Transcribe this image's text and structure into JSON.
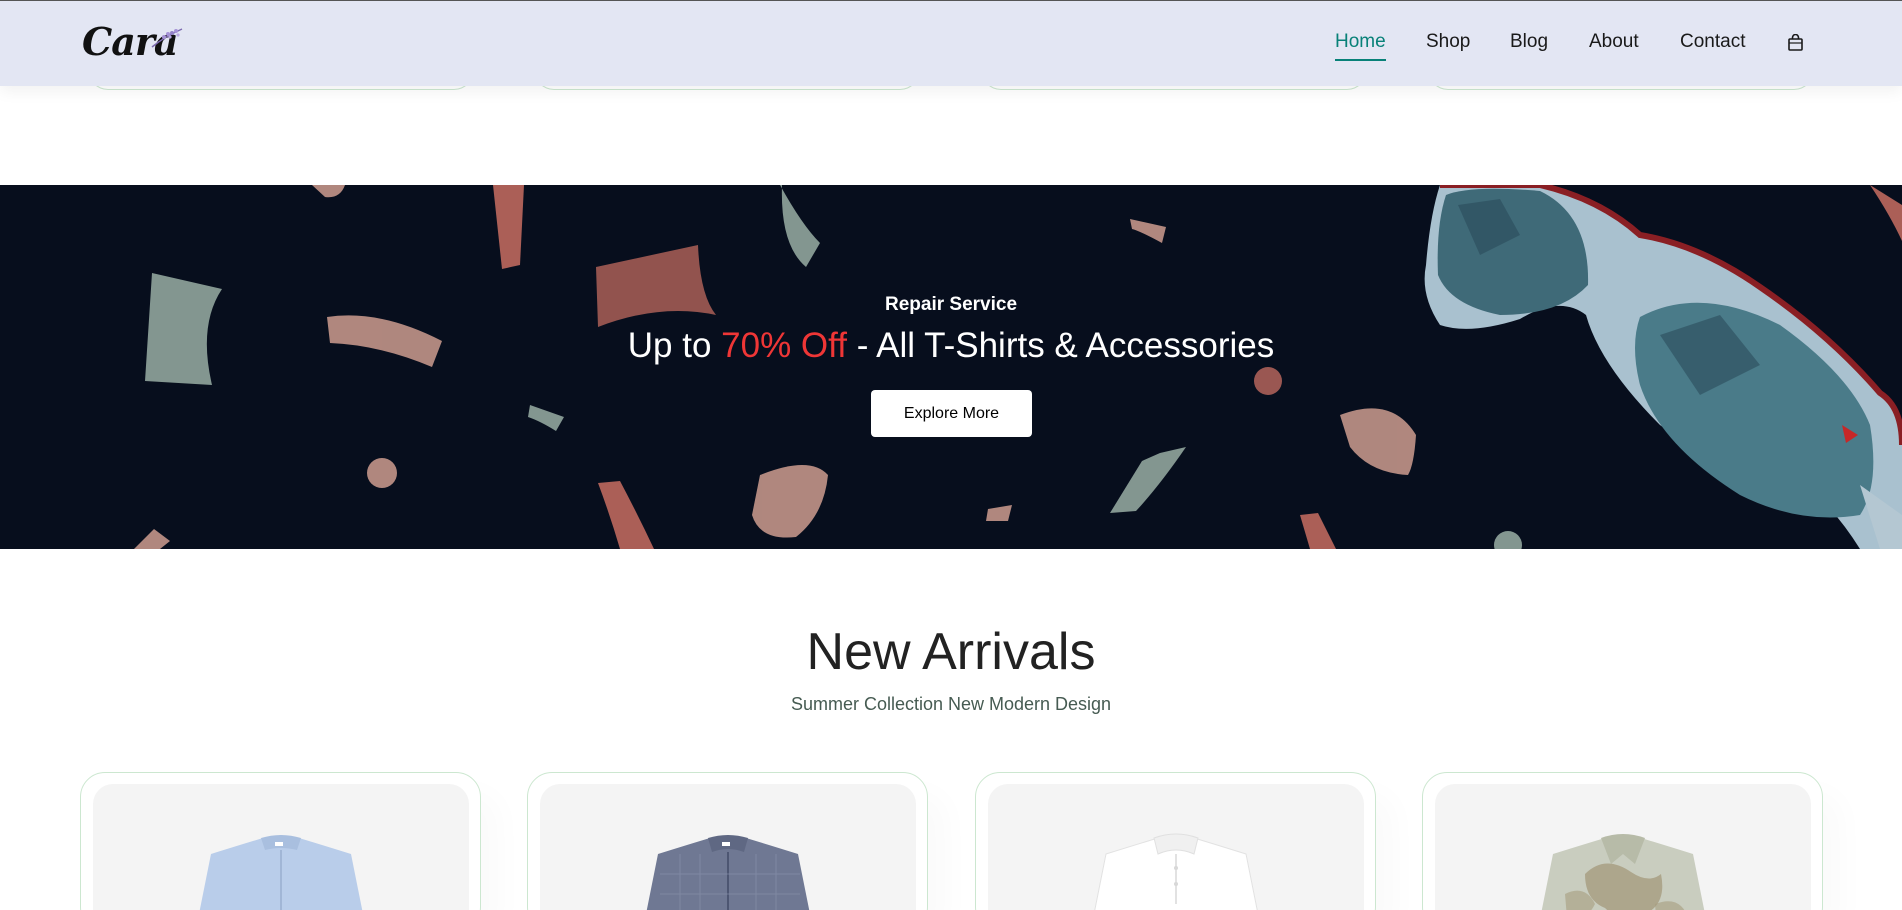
{
  "header": {
    "logo_text": "Cara",
    "nav": [
      {
        "label": "Home",
        "active": true
      },
      {
        "label": "Shop",
        "active": false
      },
      {
        "label": "Blog",
        "active": false
      },
      {
        "label": "About",
        "active": false
      },
      {
        "label": "Contact",
        "active": false
      }
    ],
    "cart_icon": "shopping-bag-icon"
  },
  "banner": {
    "subtitle": "Repair Service",
    "title_prefix": "Up to ",
    "title_highlight": "70% Off",
    "title_suffix": " - All T-Shirts & Accessories",
    "button_label": "Explore More"
  },
  "new_arrivals": {
    "title": "New Arrivals",
    "subtitle": "Summer Collection New Modern Design",
    "products": [
      {
        "image": "light-blue-shirt"
      },
      {
        "image": "navy-check-shirt"
      },
      {
        "image": "white-shirt"
      },
      {
        "image": "floral-print-shirt"
      }
    ]
  },
  "colors": {
    "header_bg": "#e3e6f3",
    "accent": "#088178",
    "banner_bg": "#070e1d",
    "highlight": "#ef3636"
  }
}
